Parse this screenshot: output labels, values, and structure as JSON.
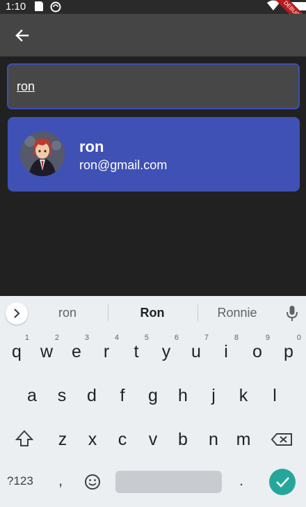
{
  "status_bar": {
    "time": "1:10"
  },
  "debug_banner": "DEBUG",
  "search": {
    "value": "ron"
  },
  "result": {
    "name": "ron",
    "email": "ron@gmail.com"
  },
  "keyboard": {
    "suggestions": [
      "ron",
      "Ron",
      "Ronnie"
    ],
    "row1": [
      {
        "ch": "q",
        "hint": "1"
      },
      {
        "ch": "w",
        "hint": "2"
      },
      {
        "ch": "e",
        "hint": "3"
      },
      {
        "ch": "r",
        "hint": "4"
      },
      {
        "ch": "t",
        "hint": "5"
      },
      {
        "ch": "y",
        "hint": "6"
      },
      {
        "ch": "u",
        "hint": "7"
      },
      {
        "ch": "i",
        "hint": "8"
      },
      {
        "ch": "o",
        "hint": "9"
      },
      {
        "ch": "p",
        "hint": "0"
      }
    ],
    "row2": [
      "a",
      "s",
      "d",
      "f",
      "g",
      "h",
      "j",
      "k",
      "l"
    ],
    "row3": [
      "z",
      "x",
      "c",
      "v",
      "b",
      "n",
      "m"
    ],
    "symbols_label": "?123",
    "comma": ",",
    "period": "."
  }
}
